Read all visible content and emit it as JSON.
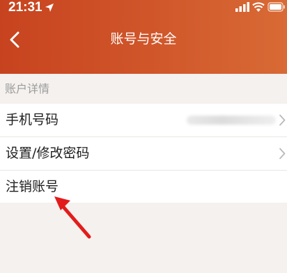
{
  "status_bar": {
    "time": "21:31"
  },
  "nav": {
    "title": "账号与安全"
  },
  "section": {
    "header": "账户详情"
  },
  "items": [
    {
      "label": "手机号码",
      "has_value": true,
      "has_chevron": true
    },
    {
      "label": "设置/修改密码",
      "has_value": false,
      "has_chevron": true
    },
    {
      "label": "注销账号",
      "has_value": false,
      "has_chevron": false
    }
  ],
  "colors": {
    "header_start": "#c7431f",
    "header_end": "#d86a35",
    "annotation_arrow": "#e21c1c",
    "background": "#f4f1ee"
  }
}
